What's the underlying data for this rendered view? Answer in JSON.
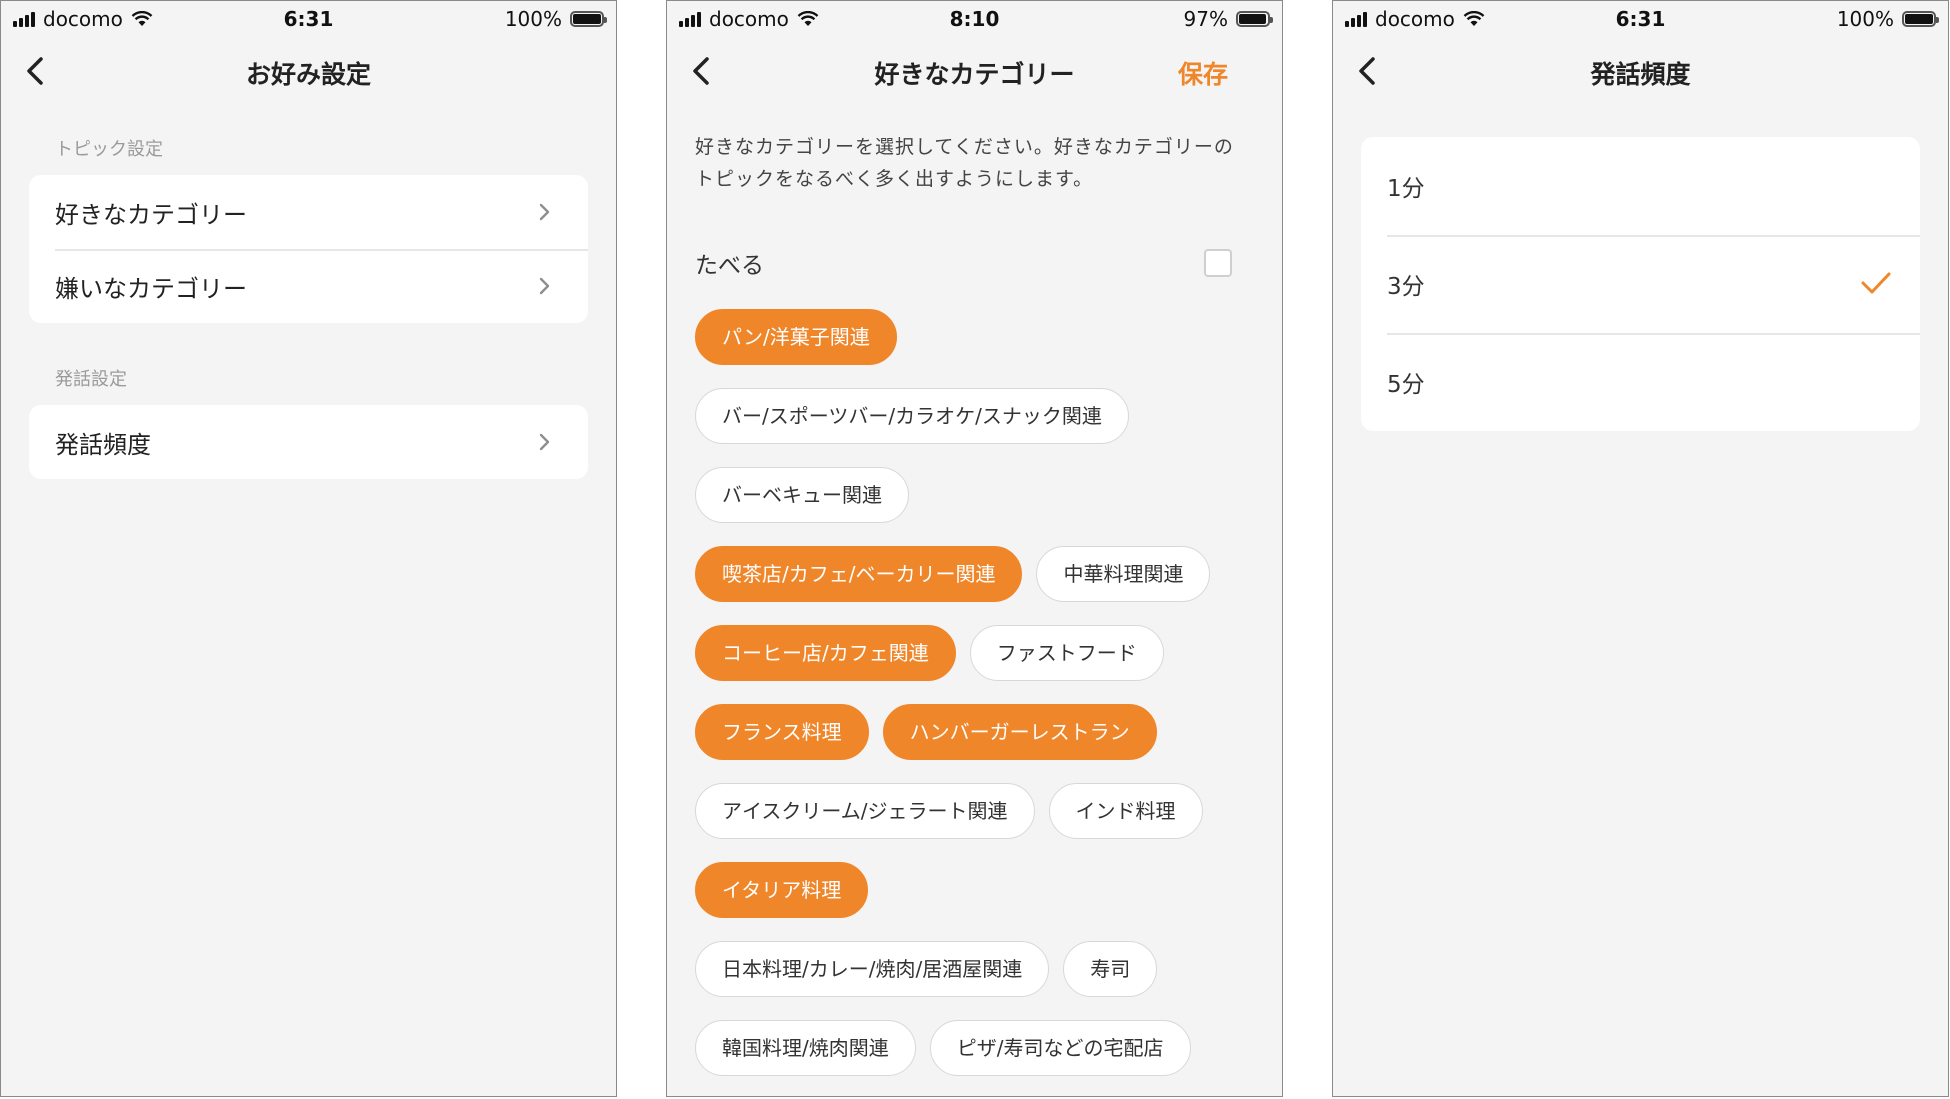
{
  "colors": {
    "accent": "#f0862a",
    "background": "#f4f4f4"
  },
  "screens": [
    {
      "status": {
        "carrier": "docomo",
        "time": "6:31",
        "battery": "100%",
        "battery_level": 1.0
      },
      "nav": {
        "title": "お好み設定"
      },
      "sections": [
        {
          "header": "トピック設定",
          "items": [
            {
              "label": "好きなカテゴリー"
            },
            {
              "label": "嫌いなカテゴリー"
            }
          ]
        },
        {
          "header": "発話設定",
          "items": [
            {
              "label": "発話頻度"
            }
          ]
        }
      ]
    },
    {
      "status": {
        "carrier": "docomo",
        "time": "8:10",
        "battery": "97%",
        "battery_level": 0.97
      },
      "nav": {
        "title": "好きなカテゴリー",
        "action": "保存"
      },
      "description": "好きなカテゴリーを選択してください。好きなカテゴリーのトピックをなるべく多く出すようにします。",
      "group": {
        "label": "たべる",
        "checked": false
      },
      "chips": [
        {
          "label": "パン/洋菓子関連",
          "selected": true
        },
        {
          "label": "バー/スポーツバー/カラオケ/スナック関連",
          "selected": false
        },
        {
          "label": "バーベキュー関連",
          "selected": false
        },
        {
          "label": "喫茶店/カフェ/ベーカリー関連",
          "selected": true
        },
        {
          "label": "中華料理関連",
          "selected": false
        },
        {
          "label": "コーヒー店/カフェ関連",
          "selected": true
        },
        {
          "label": "ファストフード",
          "selected": false
        },
        {
          "label": "フランス料理",
          "selected": true
        },
        {
          "label": "ハンバーガーレストラン",
          "selected": true
        },
        {
          "label": "アイスクリーム/ジェラート関連",
          "selected": false
        },
        {
          "label": "インド料理",
          "selected": false
        },
        {
          "label": "イタリア料理",
          "selected": true
        },
        {
          "label": "日本料理/カレー/焼肉/居酒屋関連",
          "selected": false
        },
        {
          "label": "寿司",
          "selected": false
        },
        {
          "label": "韓国料理/焼肉関連",
          "selected": false
        },
        {
          "label": "ピザ/寿司などの宅配店",
          "selected": false
        }
      ]
    },
    {
      "status": {
        "carrier": "docomo",
        "time": "6:31",
        "battery": "100%",
        "battery_level": 1.0
      },
      "nav": {
        "title": "発話頻度"
      },
      "options": [
        {
          "label": "1分",
          "selected": false
        },
        {
          "label": "3分",
          "selected": true
        },
        {
          "label": "5分",
          "selected": false
        }
      ]
    }
  ]
}
